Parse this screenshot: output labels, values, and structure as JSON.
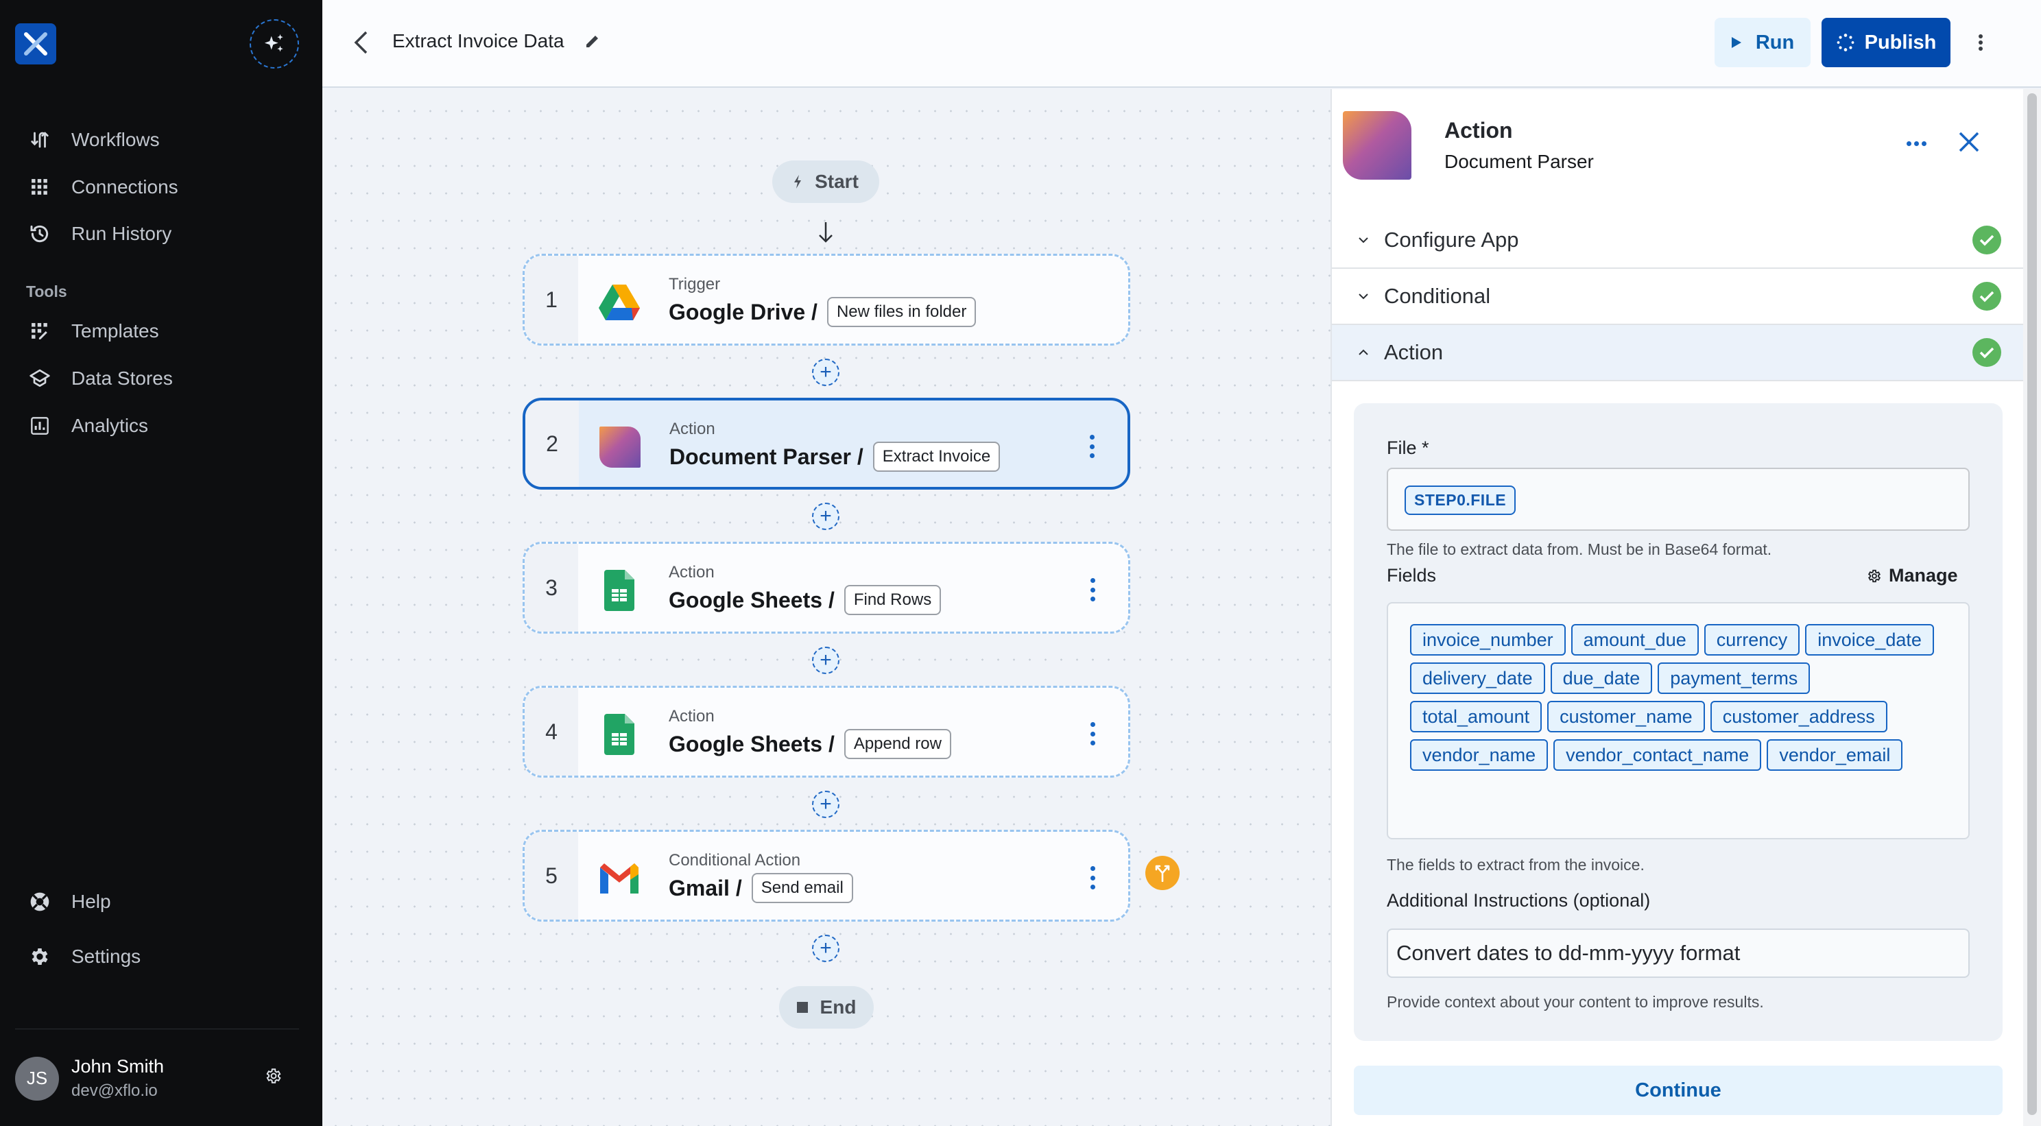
{
  "sidebar": {
    "nav": [
      {
        "label": "Workflows",
        "icon": "workflows-icon"
      },
      {
        "label": "Connections",
        "icon": "grid-icon"
      },
      {
        "label": "Run History",
        "icon": "history-icon"
      }
    ],
    "tools_heading": "Tools",
    "tools": [
      {
        "label": "Templates",
        "icon": "templates-icon"
      },
      {
        "label": "Data Stores",
        "icon": "data-stores-icon"
      },
      {
        "label": "Analytics",
        "icon": "analytics-icon"
      }
    ],
    "bottom": [
      {
        "label": "Help",
        "icon": "help-lifebuoy-icon"
      },
      {
        "label": "Settings",
        "icon": "gear-icon"
      }
    ],
    "user": {
      "initials": "JS",
      "name": "John Smith",
      "email": "dev@xflo.io"
    }
  },
  "header": {
    "title": "Extract Invoice Data",
    "run_label": "Run",
    "publish_label": "Publish"
  },
  "canvas": {
    "start_label": "Start",
    "end_label": "End",
    "steps": [
      {
        "number": "1",
        "type": "Trigger",
        "app": "Google Drive /",
        "operation": "New files in folder",
        "selected": false
      },
      {
        "number": "2",
        "type": "Action",
        "app": "Document Parser /",
        "operation": "Extract Invoice",
        "selected": true
      },
      {
        "number": "3",
        "type": "Action",
        "app": "Google Sheets /",
        "operation": "Find Rows",
        "selected": false
      },
      {
        "number": "4",
        "type": "Action",
        "app": "Google Sheets /",
        "operation": "Append row",
        "selected": false
      },
      {
        "number": "5",
        "type": "Conditional Action",
        "app": "Gmail /",
        "operation": "Send email",
        "selected": false
      }
    ]
  },
  "panel": {
    "type": "Action",
    "app_name": "Document Parser",
    "sections": [
      {
        "label": "Configure App",
        "status": "complete",
        "expanded": false
      },
      {
        "label": "Conditional",
        "status": "complete",
        "expanded": false
      },
      {
        "label": "Action",
        "status": "complete",
        "expanded": true
      }
    ],
    "file_label": "File *",
    "file_value": "STEP0.FILE",
    "file_help": "The file to extract data from. Must be in Base64 format.",
    "fields_label": "Fields",
    "manage_label": "Manage",
    "fields": [
      "invoice_number",
      "amount_due",
      "currency",
      "invoice_date",
      "delivery_date",
      "due_date",
      "payment_terms",
      "total_amount",
      "customer_name",
      "customer_address",
      "vendor_name",
      "vendor_contact_name",
      "vendor_email"
    ],
    "fields_help": "The fields to extract from the invoice.",
    "instructions_label": "Additional Instructions (optional)",
    "instructions_value": "Convert dates to dd-mm-yyyy format",
    "instructions_help": "Provide context about your content to improve results.",
    "continue_label": "Continue"
  },
  "colors": {
    "accent": "#024aad",
    "selected_border": "#1765c4",
    "success": "#5cb65f",
    "branch": "#f5a623",
    "sidebar_bg": "#0d0e10"
  }
}
